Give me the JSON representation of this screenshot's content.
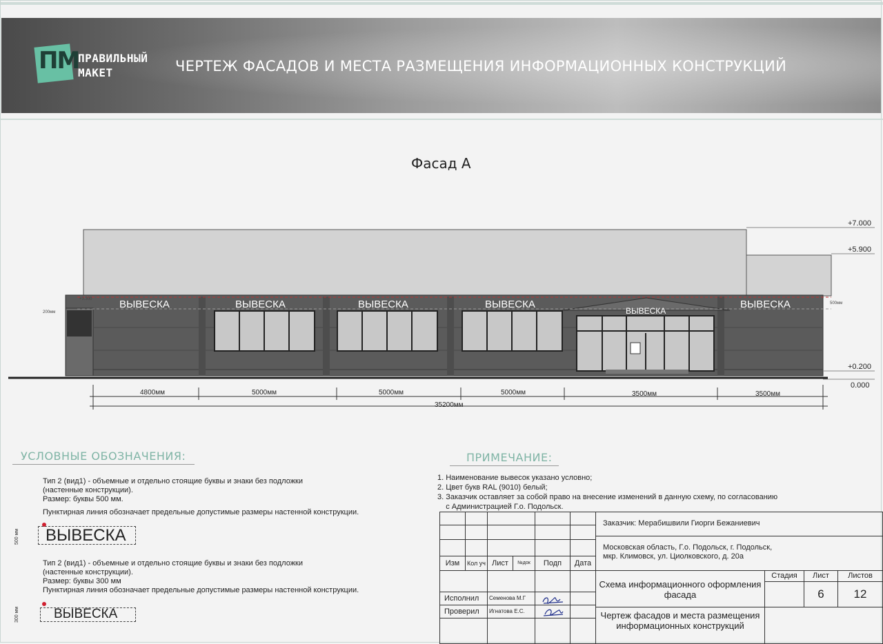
{
  "header": {
    "logo_mark": "ПМ",
    "logo_line1": "ПРАВИЛЬНЫЙ",
    "logo_line2": "МАКЕТ",
    "title": "ЧЕРТЕЖ ФАСАДОВ И МЕСТА РАЗМЕЩЕНИЯ ИНФОРМАЦИОННЫХ КОНСТРУКЦИЙ"
  },
  "drawing": {
    "title": "Фасад А",
    "signs": [
      "ВЫВЕСКА",
      "ВЫВЕСКА",
      "ВЫВЕСКА",
      "ВЫВЕСКА",
      "ВЫВЕСКА",
      "ВЫВЕСКА"
    ],
    "levels": [
      "+7.000",
      "+5.900",
      "+0.200",
      "0.000"
    ],
    "dimensions": [
      "4800мм",
      "5000мм",
      "5000мм",
      "5000мм",
      "3500мм",
      "3500мм"
    ],
    "total_dimension": "35200мм",
    "small_labels": [
      "200мм",
      "500мм",
      "+3.300"
    ]
  },
  "legend": {
    "title": "УСЛОВНЫЕ ОБОЗНАЧЕНИЯ:",
    "block1": [
      "Тип 2 (вид1) - объемные и отдельно  стоящие буквы и знаки без подложки",
      "(настенные конструкции).",
      "Размер: буквы 500 мм.",
      "Пунктирная линия обозначает предельные  допустимые размеры настенной конструкции."
    ],
    "sample1": "ВЫВЕСКА",
    "sample1_size": "500 мм",
    "block2": [
      "Тип 2 (вид1) - объемные и отдельно  стоящие буквы и знаки без подложки",
      "(настенные конструкции).",
      "Размер: буквы 300 мм",
      "Пунктирная линия обозначает предельные  допустимые размеры настенной конструкции."
    ],
    "sample2": "ВЫВЕСКА",
    "sample2_size": "300 мм"
  },
  "notes": {
    "title": "ПРИМЕЧАНИЕ:",
    "items": [
      "1. Наименование вывесок указано  условно;",
      "2. Цвет букв RAL (9010) белый;",
      "3. Заказчик оставляет за собой право на внесение изменений  в данную схему, по согласованию",
      "    с Администрацией Г.о. Подольск."
    ]
  },
  "stamp": {
    "customer": "Заказчик: Мерабишвили Гиорги Бежаниевич",
    "address_line1": "Московская область, Г.о. Подольск, г. Подольск,",
    "address_line2": "мкр. Климовск, ул. Циолковского, д. 20а",
    "col_headers": [
      "Изм",
      "Кол уч",
      "Лист",
      "№док",
      "Подп",
      "Дата"
    ],
    "executed_label": "Исполнил",
    "executed_name": "Семенова М.Г",
    "checked_label": "Проверил",
    "checked_name": "Игнатова Е.С.",
    "scheme_title": "Схема информационного оформления фасада",
    "stage_label": "Стадия",
    "sheet_label": "Лист",
    "sheets_label": "Листов",
    "sheet_value": "6",
    "sheets_value": "12",
    "drawing_title": "Чертеж фасадов и места размещения информационных конструкций"
  }
}
